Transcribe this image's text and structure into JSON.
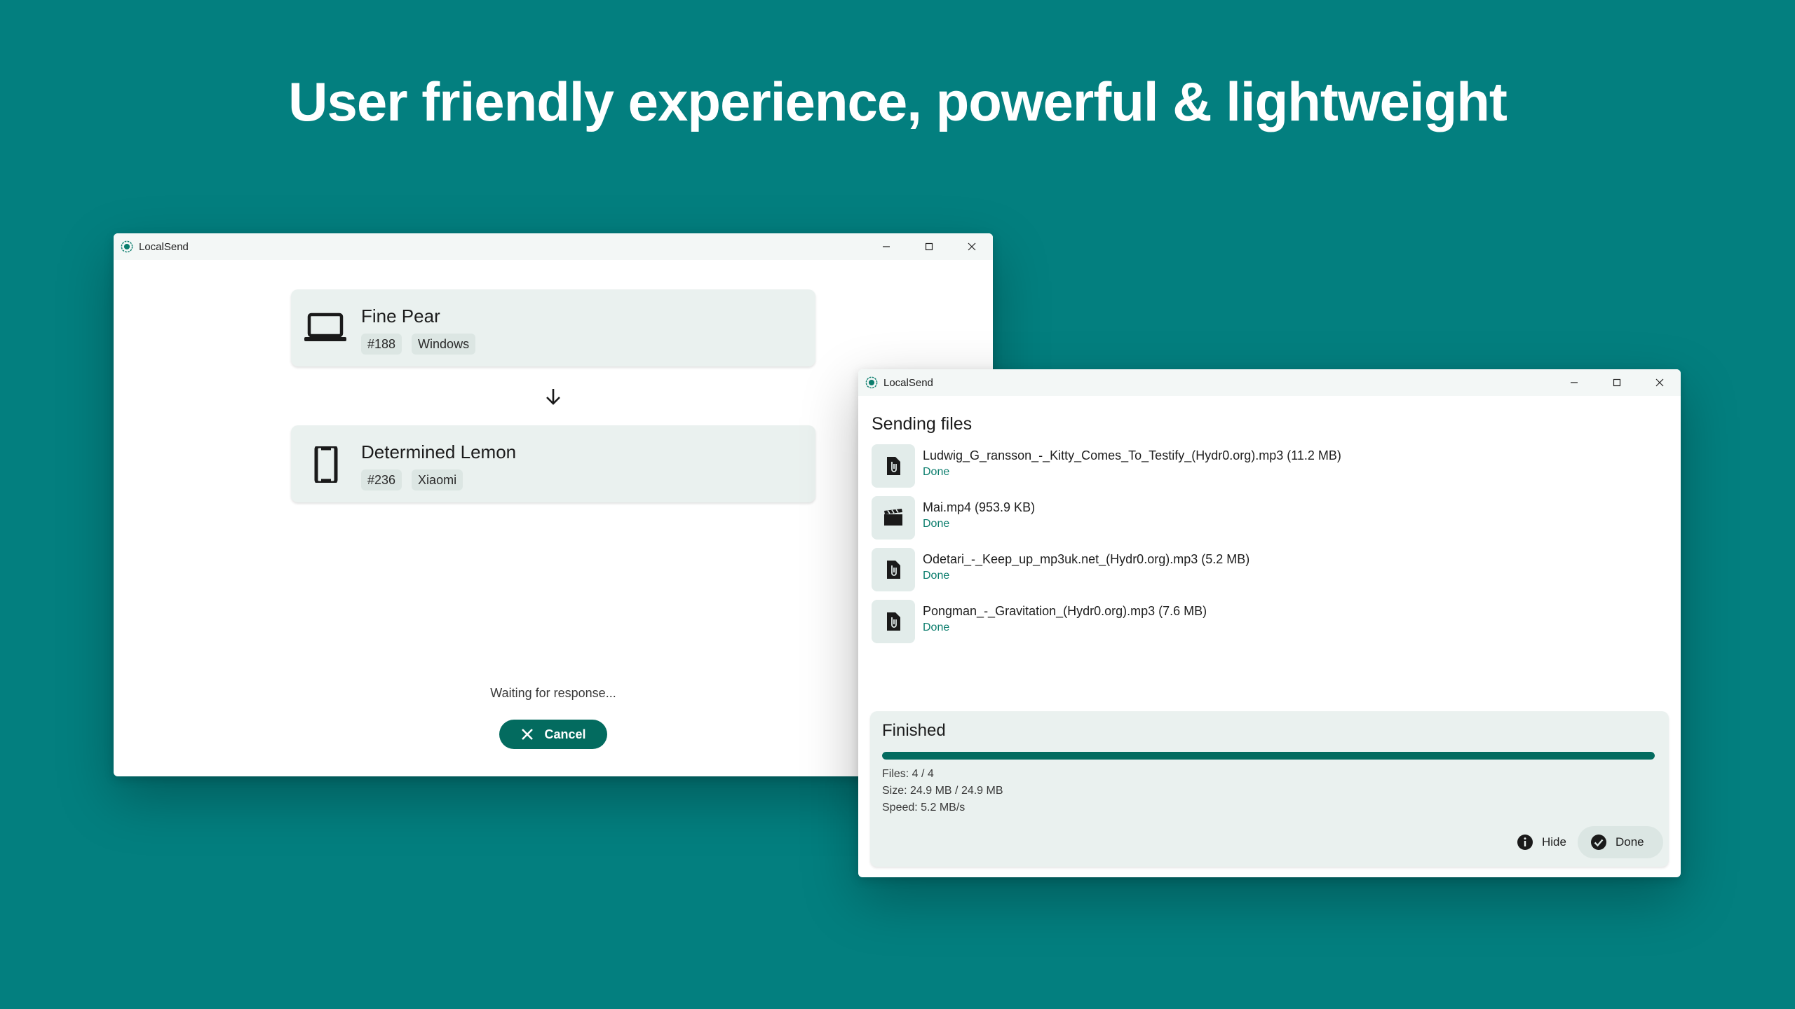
{
  "headline": "User friendly experience, powerful & lightweight",
  "colors": {
    "background": "#037f7f",
    "accent": "#036b5f",
    "card": "#eaf1ef",
    "done_text": "#0b7d6d"
  },
  "left_window": {
    "title": "LocalSend",
    "sender": {
      "name": "Fine Pear",
      "id": "#188",
      "platform": "Windows",
      "icon": "laptop-icon"
    },
    "receiver": {
      "name": "Determined Lemon",
      "id": "#236",
      "platform": "Xiaomi",
      "icon": "phone-icon"
    },
    "waiting_text": "Waiting for response...",
    "cancel_label": "Cancel"
  },
  "right_window": {
    "title": "LocalSend",
    "section_title": "Sending files",
    "files": [
      {
        "name": "Ludwig_G_ransson_-_Kitty_Comes_To_Testify_(Hydr0.org).mp3 (11.2 MB)",
        "status": "Done",
        "icon": "audio-file-icon"
      },
      {
        "name": "Mai.mp4 (953.9 KB)",
        "status": "Done",
        "icon": "video-file-icon"
      },
      {
        "name": "Odetari_-_Keep_up_mp3uk.net_(Hydr0.org).mp3 (5.2 MB)",
        "status": "Done",
        "icon": "audio-file-icon"
      },
      {
        "name": "Pongman_-_Gravitation_(Hydr0.org).mp3 (7.6 MB)",
        "status": "Done",
        "icon": "audio-file-icon"
      }
    ],
    "summary": {
      "title": "Finished",
      "progress": 1.0,
      "files": "Files: 4 / 4",
      "size": "Size: 24.9 MB / 24.9 MB",
      "speed": "Speed: 5.2 MB/s",
      "hide_label": "Hide",
      "done_label": "Done"
    }
  }
}
